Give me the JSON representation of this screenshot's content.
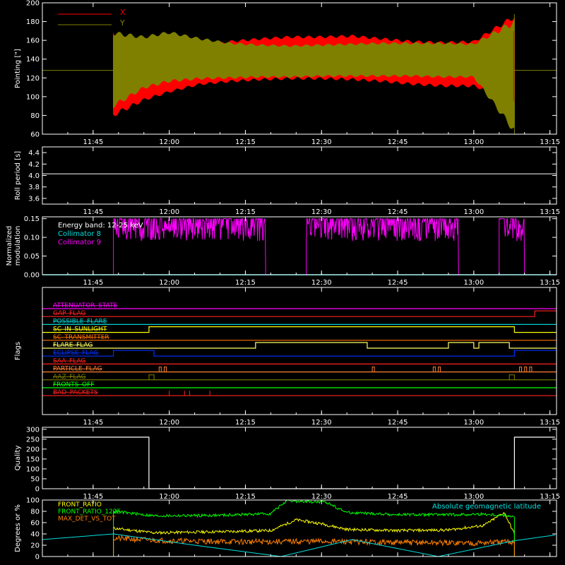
{
  "colors": {
    "background": "#000000",
    "axis": "#ffffff",
    "x_series": "#ff0000",
    "y_series": "#808000",
    "magenta": "#ff00ff",
    "cyan": "#00e0e0",
    "green": "#00ff00",
    "yellow": "#ffff00",
    "orange": "#ff8000"
  },
  "time_ticks": [
    "11:45",
    "12:00",
    "12:15",
    "12:30",
    "12:45",
    "13:00",
    "13:15"
  ],
  "chart_data": [
    {
      "id": "pointing",
      "type": "line",
      "ylabel": "Pointing [\"]",
      "ylim": [
        60,
        200
      ],
      "yticks": [
        "60",
        "80",
        "100",
        "120",
        "140",
        "160",
        "180",
        "200"
      ],
      "xlim": [
        "11:35",
        "13:16"
      ],
      "legend": [
        "X",
        "Y"
      ],
      "legend_placement": "top-left",
      "series": [
        {
          "name": "X",
          "note_time_range": [
            "11:49",
            "13:08"
          ],
          "envelope_upper": [
            170,
            150,
            148,
            155,
            160,
            163,
            165,
            165,
            166,
            163,
            160,
            159,
            160,
            188
          ],
          "envelope_lower": [
            78,
            95,
            104,
            112,
            115,
            117,
            118,
            118,
            117,
            115,
            112,
            110,
            110,
            95
          ]
        },
        {
          "name": "Y",
          "baseline": 128,
          "envelope_upper": [
            170,
            165,
            170,
            163,
            158,
            156,
            155,
            156,
            157,
            158,
            158,
            158,
            157,
            183
          ],
          "envelope_lower": [
            88,
            108,
            115,
            118,
            119,
            120,
            120,
            121,
            121,
            121,
            121,
            120,
            120,
            60
          ]
        }
      ],
      "envelope_times": [
        "11:49",
        "11:55",
        "12:00",
        "12:06",
        "12:12",
        "12:18",
        "12:24",
        "12:30",
        "12:36",
        "12:42",
        "12:48",
        "12:54",
        "13:00",
        "13:08"
      ]
    },
    {
      "id": "roll_period",
      "type": "line",
      "ylabel": "Roll period [s]",
      "ylim": [
        3.5,
        4.5
      ],
      "yticks": [
        "3.6",
        "3.8",
        "4.0",
        "4.2",
        "4.4"
      ],
      "series": [
        {
          "name": "roll",
          "constant": 4.03
        }
      ]
    },
    {
      "id": "modulation",
      "type": "line",
      "ylabel": "Normalized modulation",
      "ylim": [
        0,
        0.155
      ],
      "yticks": [
        "0.00",
        "0.05",
        "0.10",
        "0.15"
      ],
      "legend": [
        "Energy band: 12-25 keV",
        "Collimator 8",
        "Collimator 9"
      ],
      "series": [
        {
          "name": "Collimator 8",
          "constant": 0.0
        },
        {
          "name": "Collimator 9",
          "segments": [
            [
              "11:49",
              "12:19"
            ],
            [
              "12:27",
              "12:57"
            ],
            [
              "13:05",
              "13:10"
            ]
          ],
          "level_range": [
            0.09,
            0.15
          ]
        }
      ]
    },
    {
      "id": "flags",
      "type": "line",
      "ylabel": "Flags",
      "series": [
        {
          "name": "ATTENUATOR_STATE",
          "color": "#ff00ff",
          "changes": []
        },
        {
          "name": "GAP_FLAG",
          "color": "#ff2020",
          "changes": [
            [
              "13:12",
              1
            ]
          ]
        },
        {
          "name": "POSSIBLE_FLARE",
          "color": "#00d0d0",
          "changes": []
        },
        {
          "name": "SC_IN_SUNLIGHT",
          "color": "#ffff00",
          "changes": [
            [
              "11:56",
              1
            ],
            [
              "13:08",
              0
            ]
          ]
        },
        {
          "name": "SC_TRANSMITTER",
          "color": "#ff7000",
          "changes": []
        },
        {
          "name": "FLARE_FLAG",
          "color": "#ffff60",
          "changes": [
            [
              "12:17",
              1
            ],
            [
              "12:39",
              0
            ],
            [
              "12:55",
              1
            ],
            [
              "13:00",
              0
            ],
            [
              "13:01",
              1
            ],
            [
              "13:07",
              0
            ]
          ]
        },
        {
          "name": "ECLIPSE_FLAG",
          "color": "#0030ff",
          "changes": [
            [
              "11:49",
              1
            ],
            [
              "11:57",
              0
            ],
            [
              "13:08",
              1
            ]
          ]
        },
        {
          "name": "SAA_FLAG",
          "color": "#ff2020",
          "changes": []
        },
        {
          "name": "PARTICLE_FLAG",
          "color": "#ff8030",
          "changes": []
        },
        {
          "name": "AAZ_FLAG",
          "color": "#808000",
          "changes": []
        },
        {
          "name": "FRONTS_OFF",
          "color": "#00ff00",
          "changes": []
        },
        {
          "name": "BAD_PACKETS",
          "color": "#ff2020",
          "changes": []
        }
      ]
    },
    {
      "id": "quality",
      "type": "line",
      "ylabel": "Quality",
      "ylim": [
        0,
        310
      ],
      "yticks": [
        "0",
        "50",
        "100",
        "150",
        "200",
        "250",
        "300"
      ],
      "series": [
        {
          "name": "Quality",
          "points": [
            [
              "11:35",
              260
            ],
            [
              "11:56",
              260
            ],
            [
              "11:56",
              0
            ],
            [
              "13:08",
              0
            ],
            [
              "13:08",
              260
            ],
            [
              "13:16",
              260
            ]
          ]
        }
      ]
    },
    {
      "id": "front_ratio",
      "type": "line",
      "ylabel": "Degrees or %",
      "ylim": [
        0,
        100
      ],
      "yticks": [
        "0",
        "20",
        "40",
        "60",
        "80",
        "100"
      ],
      "legend": [
        "FRONT_RATIO",
        "FRONT_RATIO_1225",
        "MAX_DET_VS_TOT"
      ],
      "annotation": "Absolute geomagnetic latitude",
      "series": [
        {
          "name": "FRONT_RATIO",
          "color": "#ffff00",
          "times": [
            "11:49",
            "11:57",
            "12:10",
            "12:20",
            "12:25",
            "12:30",
            "12:35",
            "12:45",
            "12:55",
            "13:02",
            "13:06",
            "13:08"
          ],
          "values": [
            50,
            42,
            44,
            46,
            65,
            58,
            48,
            46,
            47,
            55,
            78,
            40
          ]
        },
        {
          "name": "FRONT_RATIO_1225",
          "color": "#00ff00",
          "times": [
            "11:49",
            "11:57",
            "12:10",
            "12:20",
            "12:23",
            "12:31",
            "12:35",
            "12:45",
            "12:55",
            "13:02",
            "13:07",
            "13:08"
          ],
          "values": [
            80,
            72,
            73,
            76,
            98,
            96,
            78,
            74,
            74,
            75,
            72,
            70
          ]
        },
        {
          "name": "MAX_DET_VS_TOT",
          "color": "#ff8000",
          "times": [
            "11:49",
            "12:00",
            "12:15",
            "12:30",
            "12:45",
            "13:00",
            "13:08"
          ],
          "values": [
            32,
            28,
            26,
            27,
            25,
            24,
            26
          ]
        },
        {
          "name": "Absolute geomagnetic latitude",
          "color": "#00e0e0",
          "times": [
            "11:35",
            "11:49",
            "12:05",
            "12:22",
            "12:36",
            "12:53",
            "13:08",
            "13:16"
          ],
          "values": [
            30,
            40,
            20,
            0,
            30,
            0,
            28,
            38
          ]
        }
      ]
    }
  ]
}
